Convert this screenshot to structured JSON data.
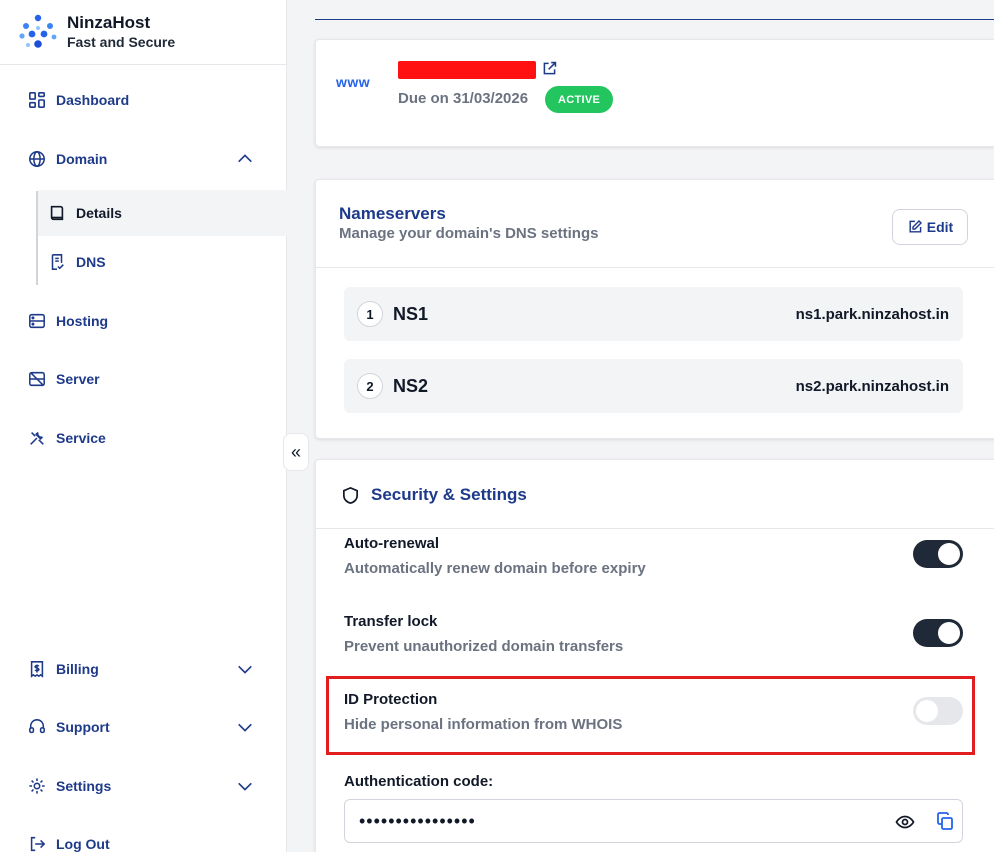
{
  "brand": {
    "name": "NinzaHost",
    "tagline": "Fast and Secure"
  },
  "sidebar": {
    "items": [
      {
        "label": "Dashboard",
        "icon": "dashboard-icon"
      },
      {
        "label": "Domain",
        "icon": "globe-icon",
        "expanded": true
      },
      {
        "label": "Hosting",
        "icon": "hosting-icon"
      },
      {
        "label": "Server",
        "icon": "server-icon"
      },
      {
        "label": "Service",
        "icon": "service-icon"
      },
      {
        "label": "Billing",
        "icon": "billing-icon"
      },
      {
        "label": "Support",
        "icon": "support-icon"
      },
      {
        "label": "Settings",
        "icon": "gear-icon"
      },
      {
        "label": "Log Out",
        "icon": "logout-icon"
      }
    ],
    "domain_sub": [
      {
        "label": "Details",
        "icon": "book-icon",
        "active": true
      },
      {
        "label": "DNS",
        "icon": "dns-icon",
        "active": false
      }
    ],
    "collapse_glyph": "«"
  },
  "domain": {
    "icon_text": "www",
    "due": "Due on 31/03/2026",
    "status": "ACTIVE"
  },
  "nameservers": {
    "title": "Nameservers",
    "subtitle": "Manage your domain's DNS settings",
    "edit_label": "Edit",
    "rows": [
      {
        "num": "1",
        "label": "NS1",
        "value": "ns1.park.ninzahost.in"
      },
      {
        "num": "2",
        "label": "NS2",
        "value": "ns2.park.ninzahost.in"
      }
    ]
  },
  "security": {
    "title": "Security & Settings",
    "settings": [
      {
        "label": "Auto-renewal",
        "desc": "Automatically renew domain before expiry",
        "enabled": true
      },
      {
        "label": "Transfer lock",
        "desc": "Prevent unauthorized domain transfers",
        "enabled": true
      },
      {
        "label": "ID Protection",
        "desc": "Hide personal information from WHOIS",
        "enabled": false
      }
    ],
    "auth_label": "Authentication code:",
    "auth_value": "••••••••••••••••"
  },
  "colors": {
    "accent": "#1e3a8a",
    "active_badge": "#22c55e",
    "highlight": "#e11d1d",
    "redaction": "#ff1111"
  }
}
